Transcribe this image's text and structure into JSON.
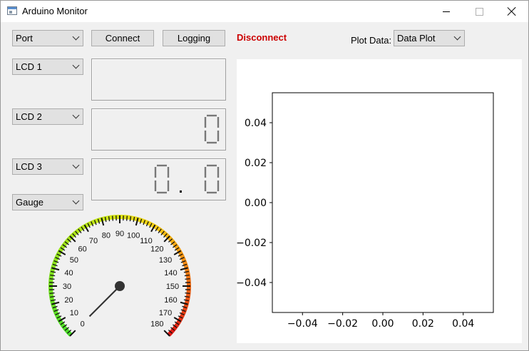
{
  "window": {
    "title": "Arduino Monitor"
  },
  "controls": {
    "port_select": "Port",
    "connect_label": "Connect",
    "logging_label": "Logging",
    "status": "Disconnect",
    "plot_label": "Plot Data:",
    "plot_select": "Data Plot"
  },
  "lcds": [
    {
      "select": "LCD 1",
      "value": ""
    },
    {
      "select": "LCD 2",
      "value": "0"
    },
    {
      "select": "LCD 3",
      "value": "0.0"
    }
  ],
  "gauge": {
    "select": "Gauge",
    "min": 0,
    "max": 180,
    "value": 0,
    "tick_labels": [
      "0",
      "10",
      "20",
      "30",
      "40",
      "50",
      "60",
      "70",
      "80",
      "90",
      "100",
      "110",
      "120",
      "130",
      "140",
      "150",
      "160",
      "170",
      "180"
    ]
  },
  "chart_data": {
    "type": "line",
    "title": "",
    "xlabel": "",
    "ylabel": "",
    "series": [],
    "xlim": [
      -0.055,
      0.055
    ],
    "ylim": [
      -0.055,
      0.055
    ],
    "x_ticks": [
      "−0.04",
      "−0.02",
      "0.00",
      "0.02",
      "0.04"
    ],
    "y_ticks": [
      "0.04",
      "0.02",
      "0.00",
      "−0.02",
      "−0.04"
    ],
    "x_tick_values": [
      -0.04,
      -0.02,
      0,
      0.02,
      0.04
    ],
    "y_tick_values": [
      0.04,
      0.02,
      0,
      -0.02,
      -0.04
    ],
    "grid": false
  }
}
